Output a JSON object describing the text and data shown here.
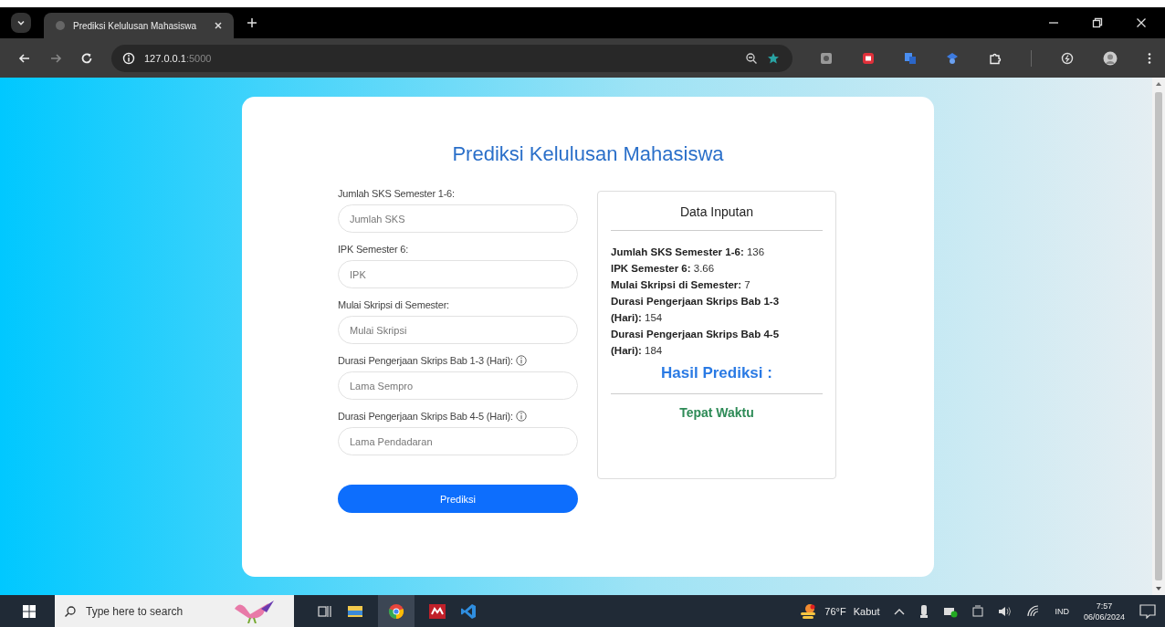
{
  "browser": {
    "tab_title": "Prediksi Kelulusan Mahasiswa",
    "url_host": "127.0.0.1",
    "url_port": ":5000"
  },
  "form": {
    "title": "Prediksi Kelulusan Mahasiswa",
    "fields": [
      {
        "label": "Jumlah SKS Semester 1-6:",
        "placeholder": "Jumlah SKS",
        "info": false
      },
      {
        "label": "IPK Semester 6:",
        "placeholder": "IPK",
        "info": false
      },
      {
        "label": "Mulai Skripsi di Semester:",
        "placeholder": "Mulai Skripsi",
        "info": false
      },
      {
        "label": "Durasi Pengerjaan Skrips Bab 1-3 (Hari):",
        "placeholder": "Lama Sempro",
        "info": true
      },
      {
        "label": "Durasi Pengerjaan Skrips Bab 4-5 (Hari):",
        "placeholder": "Lama Pendadaran",
        "info": true
      }
    ],
    "button": "Prediksi"
  },
  "result_panel": {
    "title": "Data Inputan",
    "items": [
      {
        "label": "Jumlah SKS Semester 1-6:",
        "value": "136"
      },
      {
        "label": "IPK Semester 6:",
        "value": "3.66"
      },
      {
        "label": "Mulai Skripsi di Semester:",
        "value": "7"
      },
      {
        "label": "Durasi Pengerjaan Skrips Bab 1-3 (Hari):",
        "value": "154"
      },
      {
        "label": "Durasi Pengerjaan Skrips Bab 4-5 (Hari):",
        "value": "184"
      }
    ],
    "result_heading": "Hasil Prediksi :",
    "result": "Tepat Waktu"
  },
  "taskbar": {
    "search_placeholder": "Type here to search",
    "temperature": "76°F",
    "weather": "Kabut",
    "language": "IND",
    "time": "7:57",
    "date": "06/06/2024"
  }
}
